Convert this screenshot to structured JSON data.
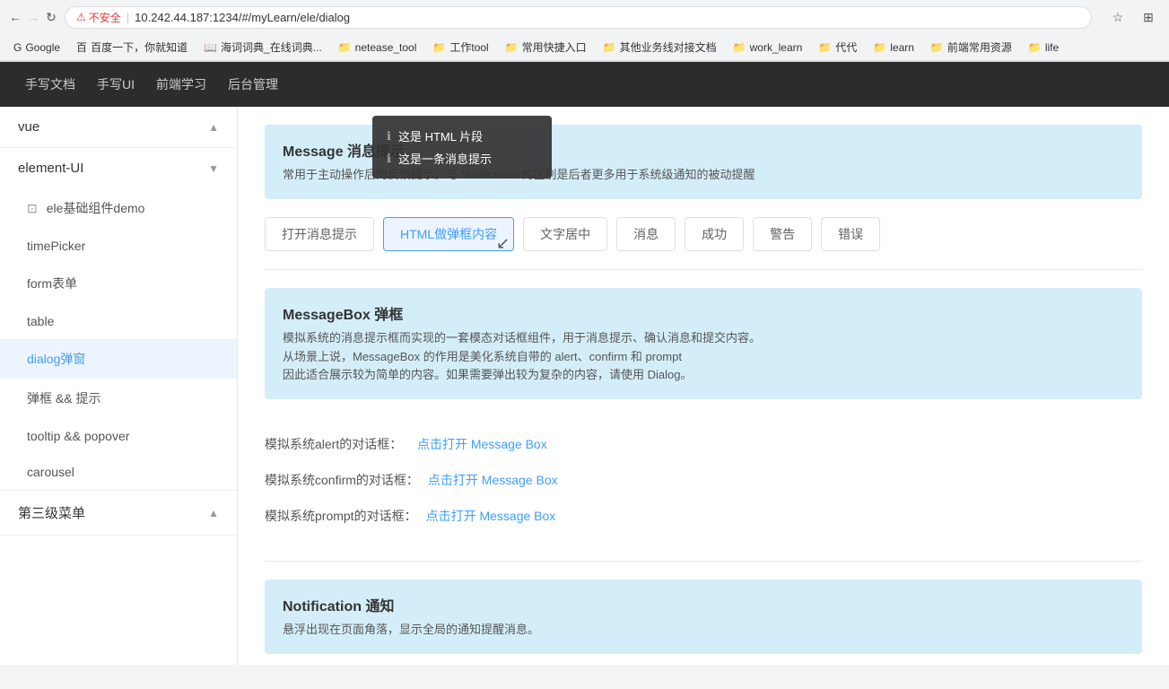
{
  "browser": {
    "security_text": "不安全",
    "url": "10.242.44.187:1234/#/myLearn/ele/dialog",
    "back_icon": "←",
    "forward_icon": "→",
    "reload_icon": "↻"
  },
  "bookmarks": [
    {
      "label": "Google",
      "icon": "G"
    },
    {
      "label": "百度一下，你就知道",
      "icon": "百"
    },
    {
      "label": "海词词典_在线词典...",
      "icon": "📖"
    },
    {
      "label": "netease_tool",
      "icon": "📁"
    },
    {
      "label": "工作tool",
      "icon": "📁"
    },
    {
      "label": "常用快捷入口",
      "icon": "📁"
    },
    {
      "label": "其他业务线对接文档",
      "icon": "📁"
    },
    {
      "label": "work_learn",
      "icon": "📁"
    },
    {
      "label": "代代",
      "icon": "📁"
    },
    {
      "label": "learn",
      "icon": "📁"
    },
    {
      "label": "前端常用资源",
      "icon": "📁"
    },
    {
      "label": "life",
      "icon": "📁"
    }
  ],
  "topnav": {
    "items": [
      {
        "label": "手写文档"
      },
      {
        "label": "手写UI"
      },
      {
        "label": "前端学习"
      },
      {
        "label": "后台管理"
      }
    ]
  },
  "sidebar": {
    "sections": [
      {
        "label": "vue",
        "expanded": true,
        "icon_collapsed": "▲"
      },
      {
        "label": "element-UI",
        "expanded": true,
        "icon_collapsed": "▼",
        "items": [
          {
            "label": "ele基础组件demo",
            "icon": "▭",
            "indent": false
          },
          {
            "label": "timePicker",
            "indent": true
          },
          {
            "label": "form表单",
            "indent": true
          },
          {
            "label": "table",
            "indent": true
          },
          {
            "label": "dialog弹窗",
            "indent": true,
            "active": true
          },
          {
            "label": "弹框 && 提示",
            "indent": true
          },
          {
            "label": "tooltip && popover",
            "indent": true
          },
          {
            "label": "carousel",
            "indent": true
          }
        ]
      },
      {
        "label": "第三级菜单",
        "expanded": true,
        "icon_collapsed": "▲"
      }
    ]
  },
  "content": {
    "tooltip_overlay": {
      "item1": "这是 HTML 片段",
      "item2": "这是一条消息提示"
    },
    "message_section": {
      "title": "Message 消息提示",
      "desc": "常用于主动操作后的反馈提示。与 Notification 的区别是后者更多用于系统级通知的被动提醒"
    },
    "message_buttons": [
      {
        "label": "打开消息提示",
        "active": false
      },
      {
        "label": "HTML做弹框内容",
        "active": true
      },
      {
        "label": "文字居中",
        "active": false
      },
      {
        "label": "消息",
        "active": false
      },
      {
        "label": "成功",
        "active": false
      },
      {
        "label": "警告",
        "active": false
      },
      {
        "label": "错误",
        "active": false
      }
    ],
    "messagebox_section": {
      "title": "MessageBox 弹框",
      "desc1": "模拟系统的消息提示框而实现的一套模态对话框组件，用于消息提示、确认消息和提交内容。",
      "desc2": "从场景上说，MessageBox 的作用是美化系统自带的 alert、confirm 和 prompt",
      "desc3": "因此适合展示较为简单的内容。如果需要弹出较为复杂的内容，请使用 Dialog。"
    },
    "messagebox_rows": [
      {
        "label": "模拟系统alert的对话框：",
        "link_text": "点击打开 Message Box"
      },
      {
        "label": "模拟系统confirm的对话框：",
        "link_text": "点击打开 Message Box"
      },
      {
        "label": "模拟系统prompt的对话框：",
        "link_text": "点击打开 Message Box"
      }
    ],
    "notification_section": {
      "title": "Notification 通知",
      "desc": "悬浮出现在页面角落，显示全局的通知提醒消息。"
    }
  }
}
